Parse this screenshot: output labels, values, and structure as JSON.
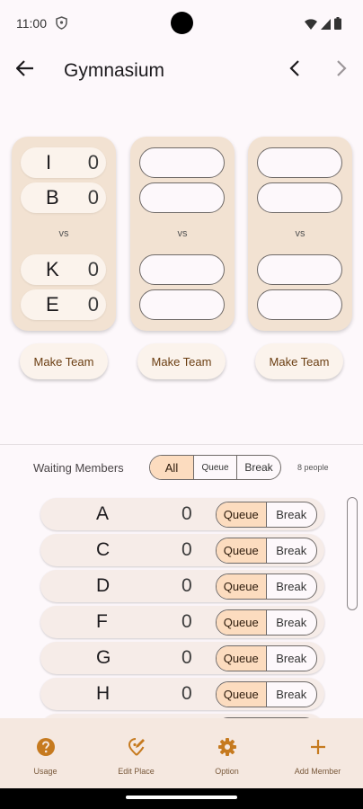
{
  "status_bar": {
    "time": "11:00"
  },
  "app_bar": {
    "title": "Gymnasium"
  },
  "courts": [
    {
      "team1": [
        {
          "name": "I",
          "score": "0"
        },
        {
          "name": "B",
          "score": "0"
        }
      ],
      "vs": "vs",
      "team2": [
        {
          "name": "K",
          "score": "0"
        },
        {
          "name": "E",
          "score": "0"
        }
      ],
      "button": "Make Team"
    },
    {
      "team1": [
        {
          "name": "",
          "score": ""
        },
        {
          "name": "",
          "score": ""
        }
      ],
      "vs": "vs",
      "team2": [
        {
          "name": "",
          "score": ""
        },
        {
          "name": "",
          "score": ""
        }
      ],
      "button": "Make Team"
    },
    {
      "team1": [
        {
          "name": "",
          "score": ""
        },
        {
          "name": "",
          "score": ""
        }
      ],
      "vs": "vs",
      "team2": [
        {
          "name": "",
          "score": ""
        },
        {
          "name": "",
          "score": ""
        }
      ],
      "button": "Make Team"
    }
  ],
  "waiting": {
    "label": "Waiting Members",
    "filters": {
      "all": "All",
      "queue": "Queue",
      "break": "Break",
      "selected": "All"
    },
    "count": "8 people",
    "members": [
      {
        "name": "A",
        "score": "0",
        "queue": "Queue",
        "break": "Break"
      },
      {
        "name": "C",
        "score": "0",
        "queue": "Queue",
        "break": "Break"
      },
      {
        "name": "D",
        "score": "0",
        "queue": "Queue",
        "break": "Break"
      },
      {
        "name": "F",
        "score": "0",
        "queue": "Queue",
        "break": "Break"
      },
      {
        "name": "G",
        "score": "0",
        "queue": "Queue",
        "break": "Break"
      },
      {
        "name": "H",
        "score": "0",
        "queue": "Queue",
        "break": "Break"
      },
      {
        "name": "",
        "score": "",
        "queue": "",
        "break": ""
      }
    ]
  },
  "bottom_nav": [
    {
      "label": "Usage",
      "icon": "help-circle-icon"
    },
    {
      "label": "Edit Place",
      "icon": "edit-place-icon"
    },
    {
      "label": "Option",
      "icon": "gear-icon"
    },
    {
      "label": "Add Member",
      "icon": "plus-icon"
    }
  ],
  "colors": {
    "accent": "#c67a1f",
    "court_bg": "#f2e2d2",
    "selected_seg": "#fcdcbf",
    "nav_bg": "#f5e8e0"
  }
}
